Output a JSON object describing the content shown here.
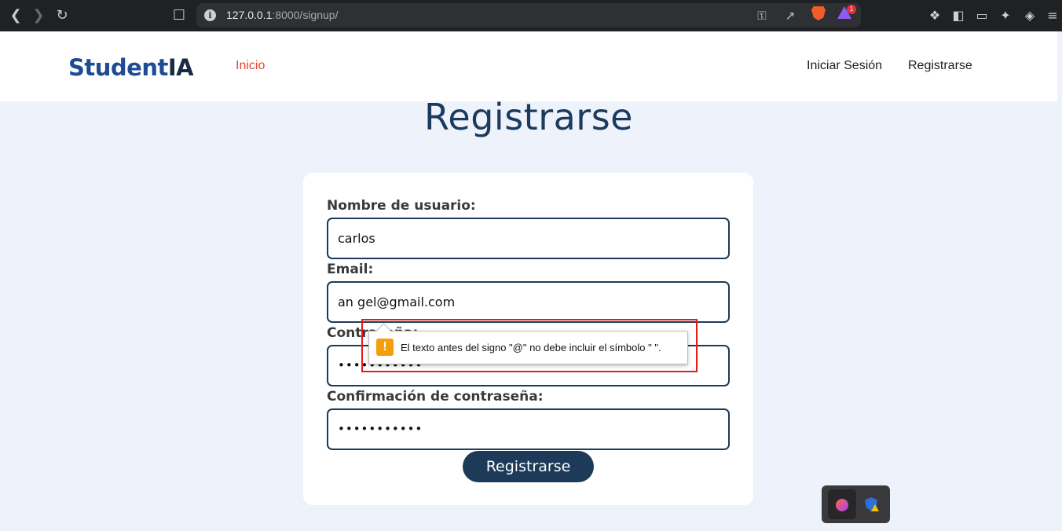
{
  "browser": {
    "url_host": "127.0.0.1",
    "url_path": ":8000/signup/",
    "rewards_badge": "1"
  },
  "nav": {
    "logo_part1": "Student",
    "logo_part2": "IA",
    "home": "Inicio",
    "login": "Iniciar Sesión",
    "register": "Registrarse"
  },
  "page": {
    "title": "Registrarse"
  },
  "form": {
    "username_label": "Nombre de usuario:",
    "username_value": "carlos",
    "email_label": "Email:",
    "email_value": "an gel@gmail.com",
    "password_label": "Contraseña:",
    "password_value": "•••••••••••",
    "confirm_label": "Confirmación de contraseña:",
    "confirm_value": "•••••••••••",
    "submit_label": "Registrarse"
  },
  "validation": {
    "icon": "!",
    "message": "El texto antes del signo \"@\" no debe incluir el símbolo \" \"."
  },
  "colors": {
    "brand_blue": "#1d4b94",
    "accent_red": "#e2492f",
    "primary_dark": "#1d3b59",
    "highlight_red": "#e31b1b"
  }
}
